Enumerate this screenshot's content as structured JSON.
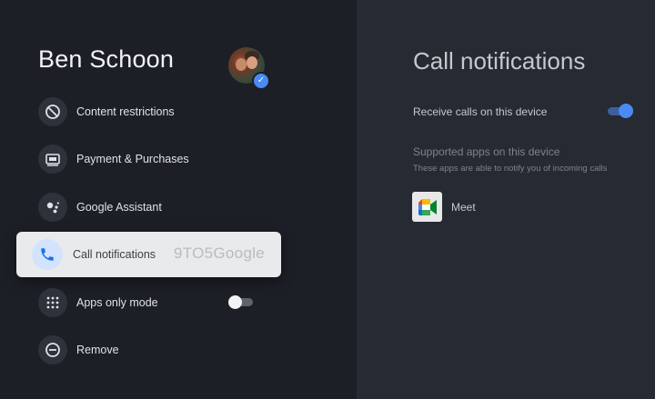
{
  "profile": {
    "name": "Ben Schoon",
    "verified_icon": "check-icon"
  },
  "menu": {
    "items": [
      {
        "label": "Content restrictions",
        "icon": "block-icon"
      },
      {
        "label": "Payment & Purchases",
        "icon": "payment-icon"
      },
      {
        "label": "Google Assistant",
        "icon": "assistant-icon"
      },
      {
        "label": "Call notifications",
        "icon": "phone-icon",
        "selected": true
      },
      {
        "label": "Apps only mode",
        "icon": "apps-grid-icon",
        "toggle": false
      },
      {
        "label": "Remove",
        "icon": "remove-icon"
      }
    ]
  },
  "watermark": "9TO5Google",
  "detail": {
    "title": "Call notifications",
    "receive_calls_label": "Receive calls on this device",
    "receive_calls_enabled": true,
    "supported_apps_title": "Supported apps on this device",
    "supported_apps_subtitle": "These apps are able to notify you of incoming calls",
    "apps": [
      {
        "label": "Meet",
        "icon": "google-meet-icon"
      }
    ]
  },
  "colors": {
    "background_left": "#1c1f26",
    "background_right": "#262a32",
    "accent": "#4a8af4",
    "selected_card": "#e9eaec"
  }
}
